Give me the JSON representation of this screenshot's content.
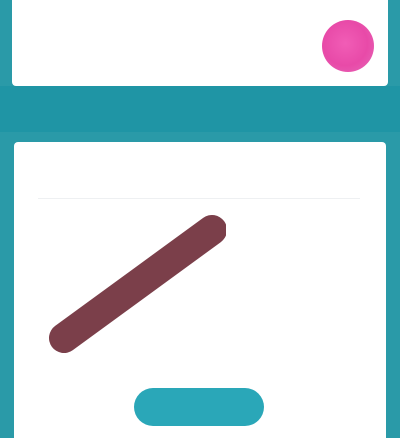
{
  "header": {
    "brand_text": "",
    "avatar_color": "#e84aa8"
  },
  "card": {
    "title": "",
    "details": [
      "",
      ""
    ],
    "price": "",
    "cta_label": ""
  },
  "colors": {
    "page_background": "#2a9aa8",
    "band": "#1f95a5",
    "card_background": "#ffffff",
    "cta_button": "#2aa7b8",
    "product_stroke": "#7b3f4a"
  }
}
